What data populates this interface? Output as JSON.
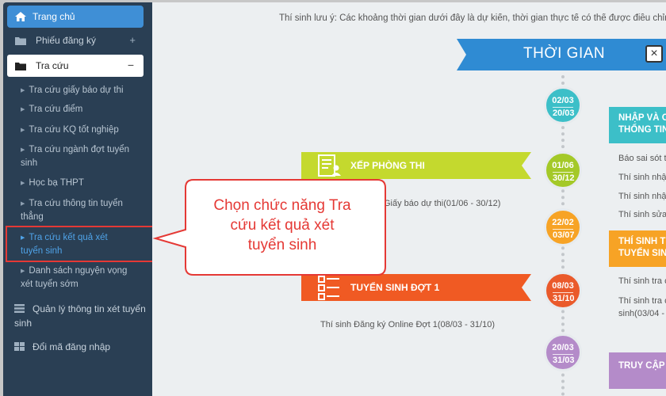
{
  "sidebar": {
    "home_label": "Trang chủ",
    "register_label": "Phiếu đăng ký",
    "register_sign": "+",
    "lookup_label": "Tra cứu",
    "lookup_sign": "−",
    "sub_items": [
      "Tra cứu giấy báo dự thi",
      "Tra cứu điểm",
      "Tra cứu KQ tốt nghiệp",
      "Tra cứu ngành đợt tuyển sinh",
      "Học bạ THPT",
      "Tra cứu thông tin tuyển thẳng",
      "Tra cứu kết quả xét tuyển sinh",
      "Danh sách nguyện vọng xét tuyển sớm"
    ],
    "manage_label": "Quản lý thông tin xét tuyển sinh",
    "password_label": "Đổi mã đăng nhập"
  },
  "main": {
    "notice": "Thí sinh lưu ý: Các khoảng thời gian dưới đây là dự kiến, thời gian thực tế có thể được điều chỉnh",
    "timeline_title": "THỜI GIAN",
    "close_symbol": "×",
    "events": [
      {
        "from": "02/03",
        "to": "20/03",
        "color": "#3cbfc8"
      },
      {
        "from": "01/06",
        "to": "30/12",
        "color": "#a4c928"
      },
      {
        "from": "22/02",
        "to": "03/07",
        "color": "#f7a325"
      },
      {
        "from": "08/03",
        "to": "31/10",
        "color": "#ea5a2b"
      },
      {
        "from": "20/03",
        "to": "31/03",
        "color": "#b48bc9"
      }
    ],
    "right_boxes": [
      {
        "line1": "NHẬP VÀ C",
        "line2": "THỐNG TIN",
        "color": "#3cbfc8"
      },
      {
        "line1": "THÍ SINH T",
        "line2": "TUYỂN SIN",
        "color": "#f7a325"
      },
      {
        "line1": "TRUY CẬP",
        "line2": "",
        "color": "#b48bc9"
      }
    ],
    "right_texts_1": [
      "Báo sai sót t",
      "Thí sinh nhập",
      "Thí sinh nhập",
      "Thí sinh sửa"
    ],
    "right_texts_2": [
      "Thí sinh tra c",
      "Thí sinh tra c",
      "sinh(03/04 -"
    ],
    "left_banners": [
      {
        "title": "XẾP PHÒNG THI",
        "color": "#c4d92e"
      },
      {
        "title": "TUYỂN SINH ĐỢT 1",
        "color": "#f05a23"
      }
    ],
    "exam_text": "Giấy báo dự thi(01/06 - 30/12)",
    "round1_text": "Thí sinh Đăng ký Online Đợt 1(08/03 - 31/10)"
  },
  "callout": {
    "text_line1": "Chọn chức năng Tra",
    "text_line2": "cứu kết quả xét",
    "text_line3": "tuyển sinh"
  }
}
